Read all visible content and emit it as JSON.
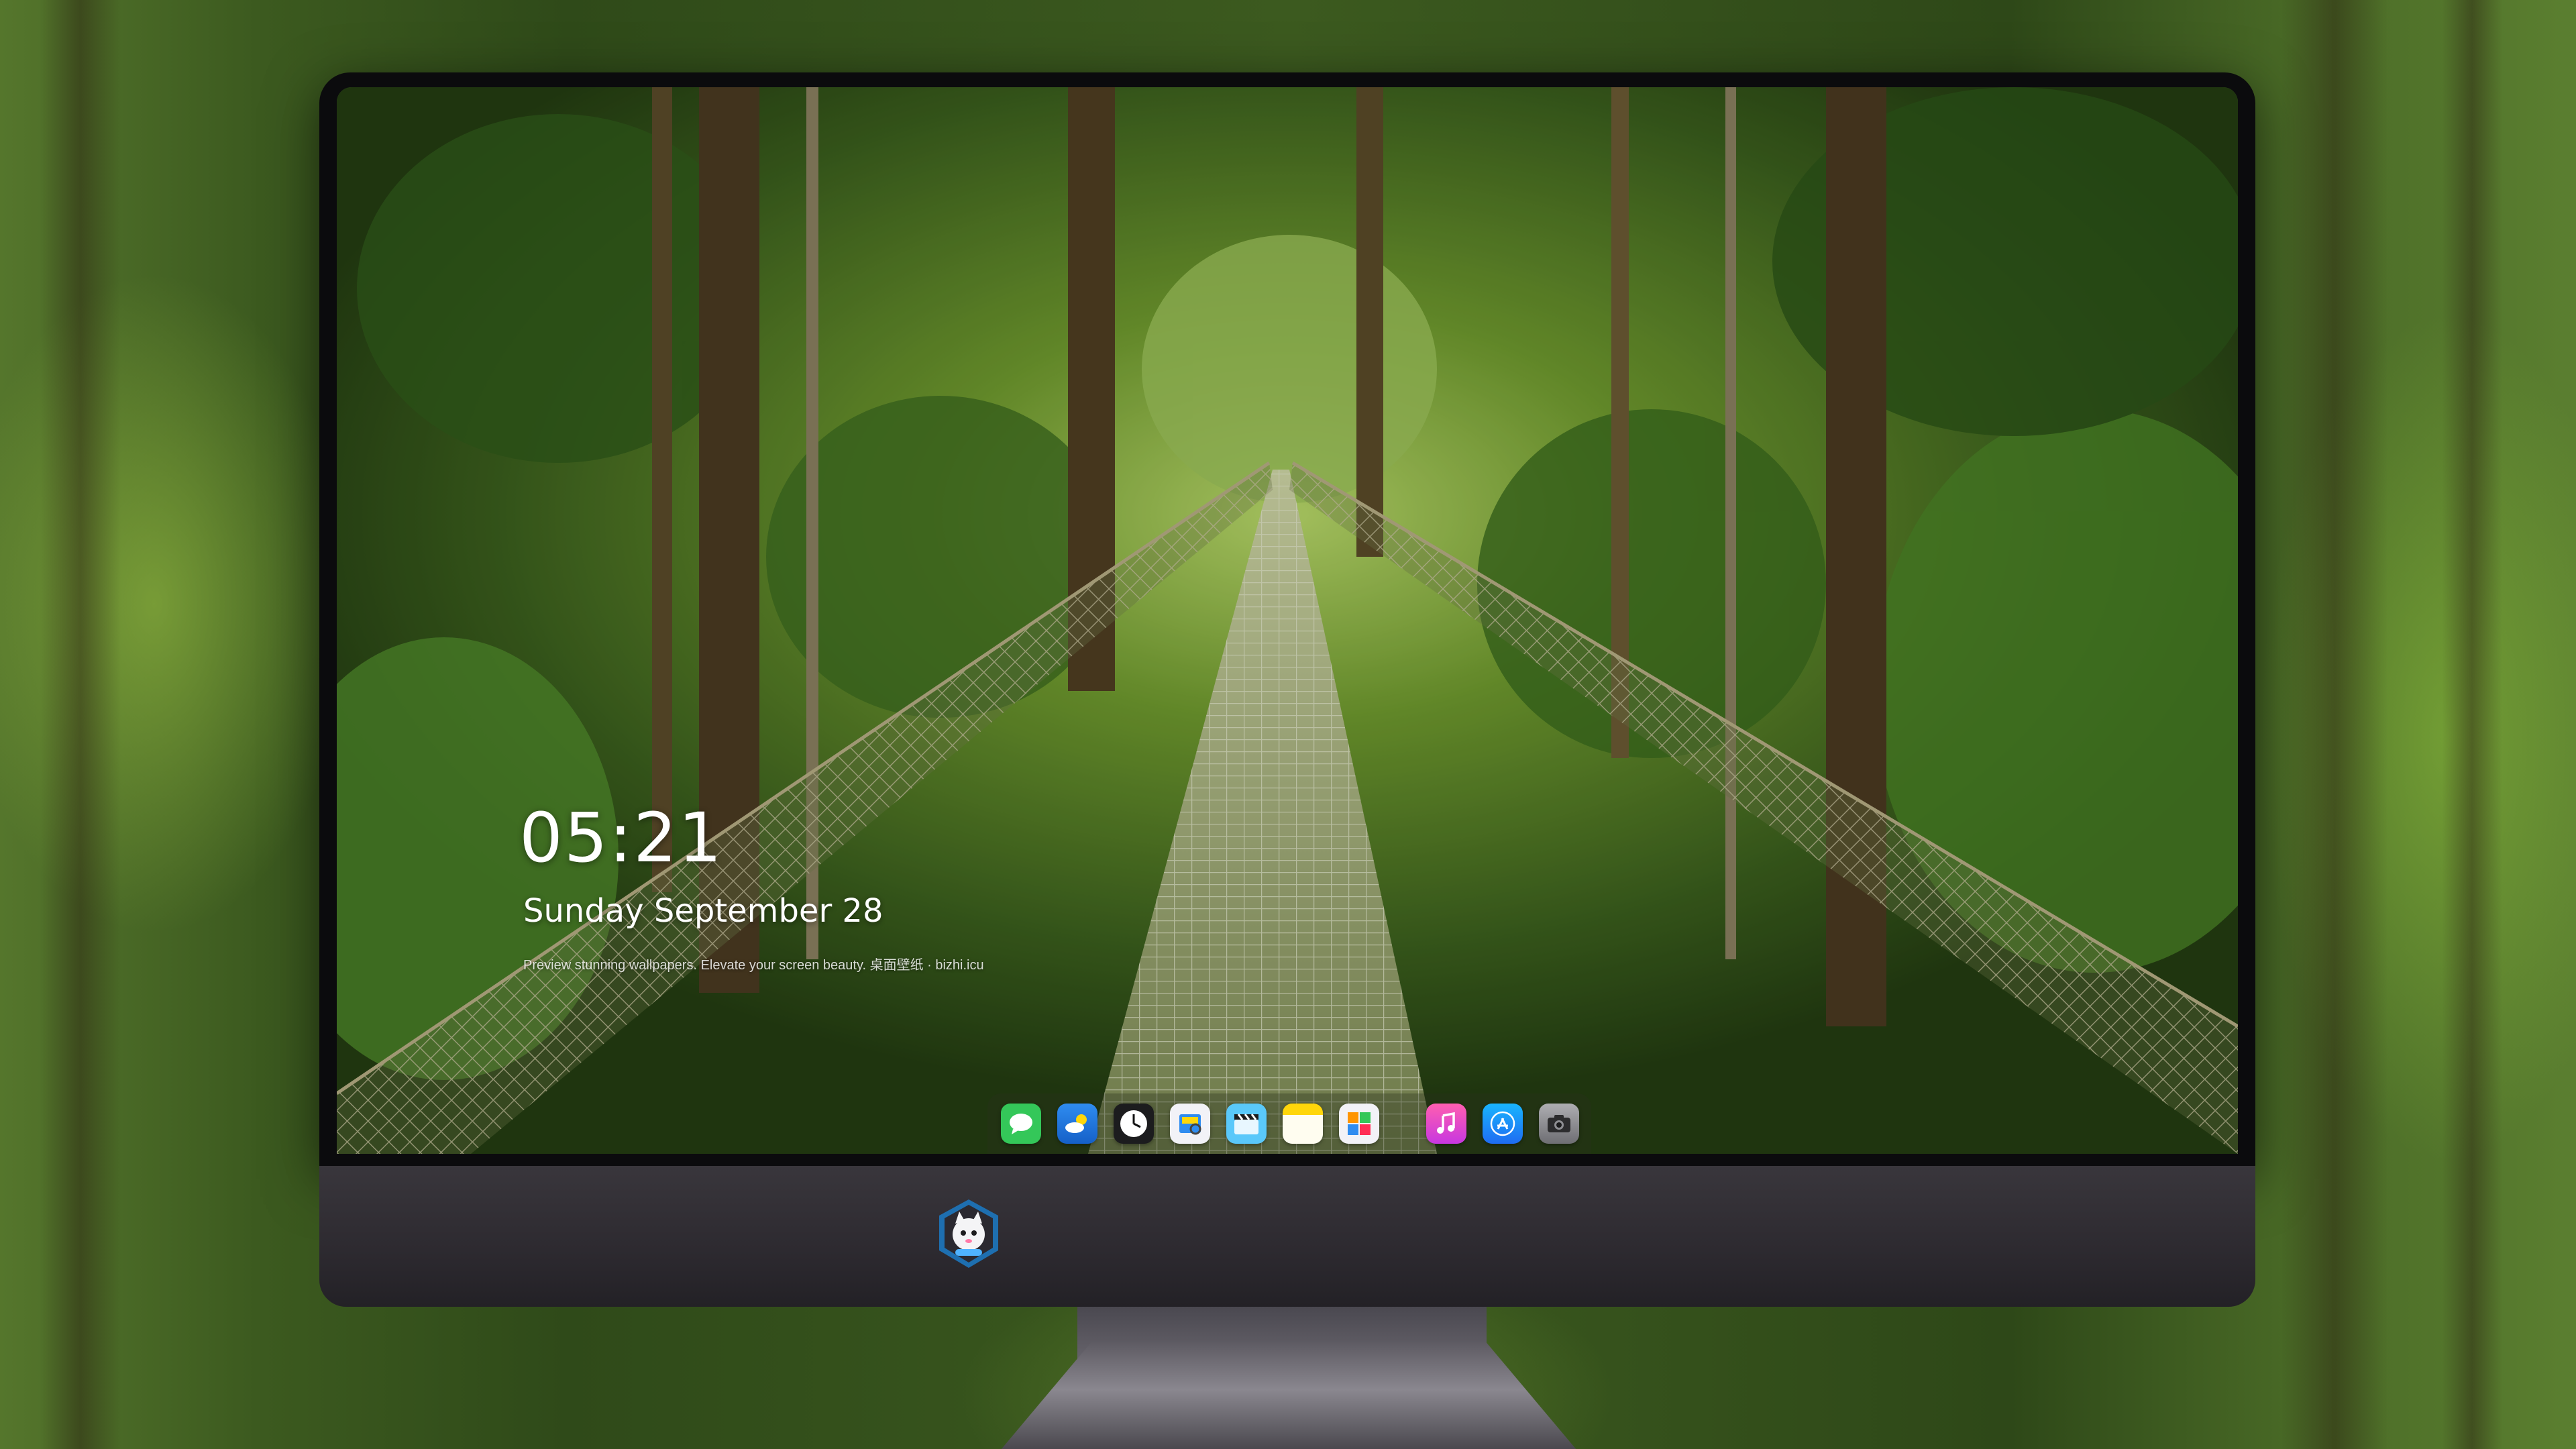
{
  "lockscreen": {
    "time": "05:21",
    "date": "Sunday September  28",
    "tagline": "Preview stunning wallpapers. Elevate your screen beauty. 桌面壁纸 · bizhi.icu"
  },
  "dock": {
    "items": [
      {
        "name": "messages-icon",
        "color": "#34c759"
      },
      {
        "name": "weather-icon",
        "color": "#2f8cf0"
      },
      {
        "name": "clock-icon",
        "color": "#1c1c1e"
      },
      {
        "name": "preview-icon",
        "color": "#f2f2f7"
      },
      {
        "name": "clips-icon",
        "color": "#5ac8fa"
      },
      {
        "name": "notes-icon",
        "color": "#ffd60a"
      },
      {
        "name": "photos-icon",
        "color": "#f2f2f7"
      },
      {
        "name": "music-icon",
        "color": "#fc3c8d"
      },
      {
        "name": "app-store-icon",
        "color": "#1e7cf2"
      },
      {
        "name": "camera-icon",
        "color": "#8e8e93"
      }
    ]
  },
  "monitor": {
    "logo": "cat-astronaut-logo-icon"
  }
}
